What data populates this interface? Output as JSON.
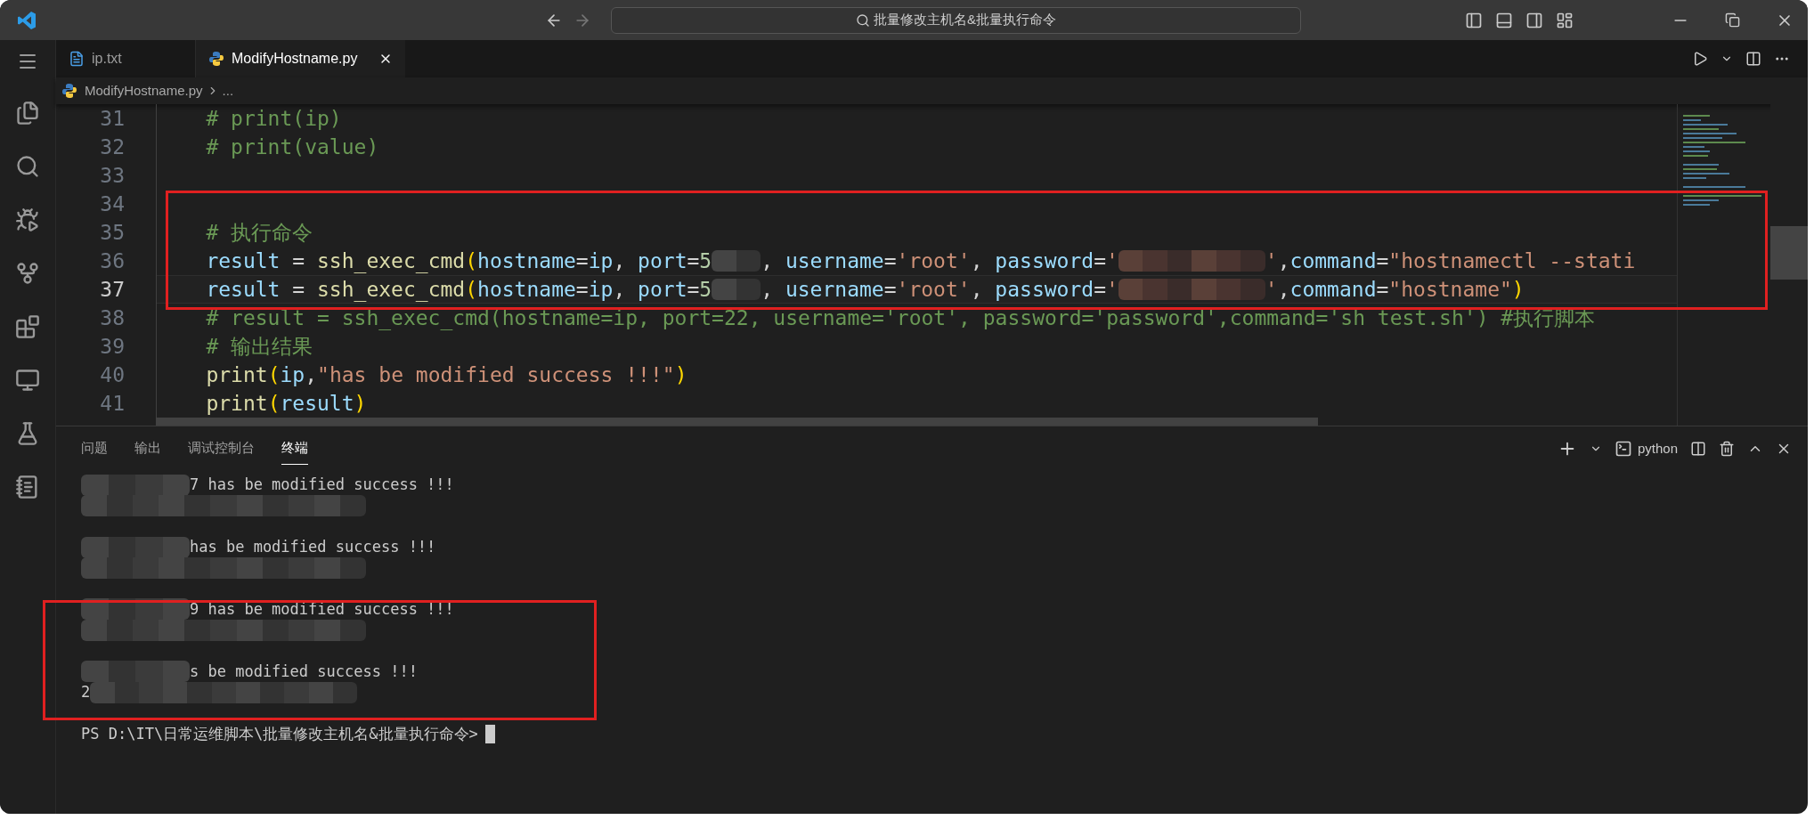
{
  "window": {
    "search": "批量修改主机名&批量执行命令"
  },
  "tabs": [
    {
      "label": "ip.txt",
      "kind": "text",
      "selected": false
    },
    {
      "label": "ModifyHostname.py",
      "kind": "python",
      "selected": true
    }
  ],
  "breadcrumb": [
    "ModifyHostname.py",
    "..."
  ],
  "editor": {
    "lines": [
      {
        "number": "31",
        "selected": false,
        "tokens": [
          {
            "kind": "comment",
            "text": "# print(ip)"
          }
        ]
      },
      {
        "number": "32",
        "selected": false,
        "tokens": [
          {
            "kind": "comment",
            "text": "# print(value)"
          }
        ]
      },
      {
        "number": "33",
        "selected": false
      },
      {
        "number": "34",
        "selected": false
      },
      {
        "number": "35",
        "selected": false,
        "tokens": [
          {
            "kind": "comment",
            "text": "# 执行命令"
          }
        ]
      },
      {
        "number": "36",
        "selected": false,
        "tokens": [
          {
            "kind": "var",
            "text": "result"
          },
          {
            "kind": "op",
            "text": " = "
          },
          {
            "kind": "func",
            "text": "ssh_exec_cmd"
          },
          {
            "kind": "paren",
            "text": "("
          },
          {
            "kind": "var",
            "text": "hostname"
          },
          {
            "kind": "op",
            "text": "="
          },
          {
            "kind": "var",
            "text": "ip"
          },
          {
            "kind": "op",
            "text": ", "
          },
          {
            "kind": "var",
            "text": "port"
          },
          {
            "kind": "op",
            "text": "="
          },
          {
            "kind": "num",
            "text": "5"
          },
          {
            "kind": "redacted_short"
          },
          {
            "kind": "op",
            "text": ", "
          },
          {
            "kind": "var",
            "text": "username"
          },
          {
            "kind": "op",
            "text": "="
          },
          {
            "kind": "str",
            "text": "'root'"
          },
          {
            "kind": "op",
            "text": ", "
          },
          {
            "kind": "var",
            "text": "password"
          },
          {
            "kind": "op",
            "text": "="
          },
          {
            "kind": "str",
            "text": "'"
          },
          {
            "kind": "redacted_long"
          },
          {
            "kind": "str",
            "text": "'"
          },
          {
            "kind": "op",
            "text": ","
          },
          {
            "kind": "var",
            "text": "command"
          },
          {
            "kind": "op",
            "text": "="
          },
          {
            "kind": "str",
            "text": "\"hostnamectl --stati"
          }
        ]
      },
      {
        "number": "37",
        "selected": true,
        "tokens": [
          {
            "kind": "var",
            "text": "result"
          },
          {
            "kind": "op",
            "text": " = "
          },
          {
            "kind": "func",
            "text": "ssh_exec_cmd"
          },
          {
            "kind": "paren",
            "text": "("
          },
          {
            "kind": "var",
            "text": "hostname"
          },
          {
            "kind": "op",
            "text": "="
          },
          {
            "kind": "var",
            "text": "ip"
          },
          {
            "kind": "op",
            "text": ", "
          },
          {
            "kind": "var",
            "text": "port"
          },
          {
            "kind": "op",
            "text": "="
          },
          {
            "kind": "num",
            "text": "5"
          },
          {
            "kind": "redacted_short"
          },
          {
            "kind": "op",
            "text": ", "
          },
          {
            "kind": "var",
            "text": "username"
          },
          {
            "kind": "op",
            "text": "="
          },
          {
            "kind": "str",
            "text": "'root'"
          },
          {
            "kind": "op",
            "text": ", "
          },
          {
            "kind": "var",
            "text": "password"
          },
          {
            "kind": "op",
            "text": "="
          },
          {
            "kind": "str",
            "text": "'"
          },
          {
            "kind": "redacted_long"
          },
          {
            "kind": "str",
            "text": "'"
          },
          {
            "kind": "op",
            "text": ","
          },
          {
            "kind": "var",
            "text": "command"
          },
          {
            "kind": "op",
            "text": "="
          },
          {
            "kind": "str",
            "text": "\"hostname\""
          },
          {
            "kind": "paren",
            "text": ")"
          }
        ]
      },
      {
        "number": "38",
        "selected": false,
        "tokens": [
          {
            "kind": "comment",
            "text": "# result = ssh_exec_cmd(hostname=ip, port=22, username='root', password='password',command='sh test.sh') #执行脚本"
          }
        ]
      },
      {
        "number": "39",
        "selected": false,
        "tokens": [
          {
            "kind": "comment",
            "text": "# 输出结果"
          }
        ]
      },
      {
        "number": "40",
        "selected": false,
        "tokens": [
          {
            "kind": "func",
            "text": "print"
          },
          {
            "kind": "paren",
            "text": "("
          },
          {
            "kind": "var",
            "text": "ip"
          },
          {
            "kind": "op",
            "text": ","
          },
          {
            "kind": "str",
            "text": "\"has be modified success !!!\""
          },
          {
            "kind": "paren",
            "text": ")"
          }
        ]
      },
      {
        "number": "41",
        "selected": false,
        "tokens": [
          {
            "kind": "func",
            "text": "print"
          },
          {
            "kind": "paren",
            "text": "("
          },
          {
            "kind": "var",
            "text": "result"
          },
          {
            "kind": "paren",
            "text": ")"
          }
        ]
      }
    ]
  },
  "panel": {
    "tabs": [
      {
        "label": "问题",
        "selected": false
      },
      {
        "label": "输出",
        "selected": false
      },
      {
        "label": "调试控制台",
        "selected": false
      },
      {
        "label": "终端",
        "selected": true
      }
    ],
    "terminal_name": "python",
    "lines": [
      {
        "kind": "text",
        "text": "7 has be modified success !!!"
      },
      {
        "kind": "blurred"
      },
      {
        "kind": "blank"
      },
      {
        "kind": "text",
        "text": "has be modified success !!!"
      },
      {
        "kind": "blurred"
      },
      {
        "kind": "blank"
      },
      {
        "kind": "text",
        "text": "9 has be modified success !!!"
      },
      {
        "kind": "blurred"
      },
      {
        "kind": "blank"
      },
      {
        "kind": "text",
        "text": "s be modified success !!!"
      },
      {
        "kind": "blurred",
        "text": "2"
      },
      {
        "kind": "blank"
      }
    ],
    "prompt": "PS D:\\IT\\日常运维脚本\\批量修改主机名&批量执行命令>"
  }
}
